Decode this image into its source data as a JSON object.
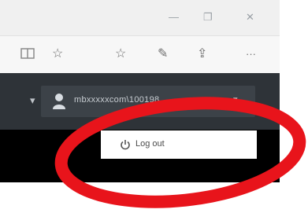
{
  "window": {
    "controls": {
      "minimize_icon": "minimize-icon",
      "restore_icon": "restore-icon",
      "close_icon": "close-icon"
    }
  },
  "toolbar": {
    "icons": [
      "reading-view-icon",
      "favorite-star-icon",
      "favorites-hub-icon",
      "web-note-icon",
      "share-icon",
      "more-icon"
    ],
    "more_label": "···"
  },
  "app": {
    "header": {
      "dropdown_caret": "▾",
      "user_menu": {
        "username": "mbxxxxxcom\\100198",
        "caret": "▾"
      }
    },
    "user_dropdown": {
      "items": [
        {
          "label": "Log out",
          "icon": "power-icon"
        }
      ]
    }
  },
  "annotation": {
    "shape": "ellipse",
    "color": "#e8141b"
  }
}
